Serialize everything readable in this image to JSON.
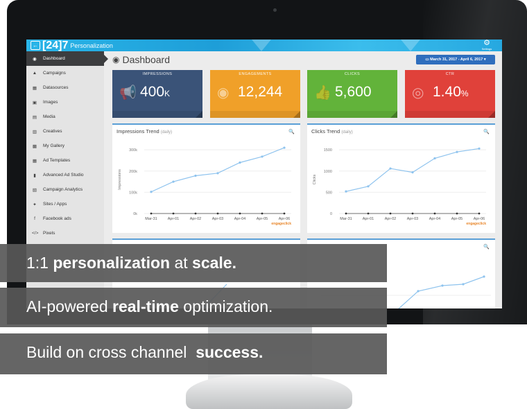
{
  "app": {
    "logo_num": "[24]7",
    "logo_sub": "Personalization",
    "settings_label": "Settings"
  },
  "sidebar": {
    "items": [
      {
        "label": "Dashboard",
        "icon": "dashboard-icon",
        "glyph": "◉",
        "active": true
      },
      {
        "label": "Campaigns",
        "icon": "campaigns-icon",
        "glyph": "▲"
      },
      {
        "label": "Datasources",
        "icon": "datasources-icon",
        "glyph": "▦"
      },
      {
        "label": "Images",
        "icon": "images-icon",
        "glyph": "▣"
      },
      {
        "label": "Media",
        "icon": "media-icon",
        "glyph": "▤"
      },
      {
        "label": "Creatives",
        "icon": "creatives-icon",
        "glyph": "▥"
      },
      {
        "label": "My Gallery",
        "icon": "gallery-icon",
        "glyph": "▩"
      },
      {
        "label": "Ad Templates",
        "icon": "templates-icon",
        "glyph": "▦"
      },
      {
        "label": "Advanced Ad Studio",
        "icon": "studio-icon",
        "glyph": "▮"
      },
      {
        "label": "Campaign Analytics",
        "icon": "analytics-icon",
        "glyph": "▧"
      },
      {
        "label": "Sites / Apps",
        "icon": "sites-icon",
        "glyph": "✦"
      },
      {
        "label": "Facebook ads",
        "icon": "facebook-icon",
        "glyph": "f"
      },
      {
        "label": "Pixels",
        "icon": "pixels-icon",
        "glyph": "</>"
      }
    ]
  },
  "header": {
    "title": "Dashboard",
    "date_range": "March 31, 2017 - April 6, 2017 ▾"
  },
  "stats": [
    {
      "label": "IMPRESSIONS",
      "value": "400",
      "unit": "K",
      "color": "#3a5378",
      "icon": "megaphone-icon",
      "glyph": "📢"
    },
    {
      "label": "ENGAGEMENTS",
      "value": "12,244",
      "unit": "",
      "color": "#f0a029",
      "icon": "eye-icon",
      "glyph": "◉"
    },
    {
      "label": "CLICKS",
      "value": "5,600",
      "unit": "",
      "color": "#62b33a",
      "icon": "thumbs-up-icon",
      "glyph": "👍"
    },
    {
      "label": "CTR",
      "value": "1.40",
      "unit": "%",
      "color": "#e0413a",
      "icon": "target-icon",
      "glyph": "◎"
    }
  ],
  "colors": {
    "accent": "#5a9fd6",
    "line": "#8ec3ee"
  },
  "chart_data": [
    {
      "type": "line",
      "title": "Impressions Trend",
      "subtitle": "(daily)",
      "ylabel": "Impressions",
      "categories": [
        "Mar-31",
        "Apr-01",
        "Apr-02",
        "Apr-03",
        "Apr-04",
        "Apr-05",
        "Apr-06"
      ],
      "ylim": [
        0,
        320000
      ],
      "ticks": [
        0,
        100000,
        200000,
        300000
      ],
      "tick_labels": [
        "0k",
        "100k",
        "200k",
        "300k"
      ],
      "series": [
        {
          "values": [
            102000,
            150000,
            178000,
            190000,
            240000,
            268000,
            310000
          ]
        }
      ],
      "watermark": "engageclick"
    },
    {
      "type": "line",
      "title": "Clicks Trend",
      "subtitle": "(daily)",
      "ylabel": "Clicks",
      "categories": [
        "Mar-31",
        "Apr-01",
        "Apr-02",
        "Apr-03",
        "Apr-04",
        "Apr-05",
        "Apr-06"
      ],
      "ylim": [
        0,
        1600
      ],
      "ticks": [
        0,
        500,
        1000,
        1500
      ],
      "tick_labels": [
        "0",
        "500",
        "1000",
        "1500"
      ],
      "series": [
        {
          "values": [
            520,
            640,
            1060,
            970,
            1300,
            1450,
            1530
          ]
        }
      ],
      "watermark": "engageclick"
    }
  ],
  "captions": [
    {
      "parts": [
        {
          "t": "1:1 ",
          "b": false
        },
        {
          "t": "personalization",
          "b": true
        },
        {
          "t": " at ",
          "b": false
        },
        {
          "t": "scale.",
          "b": true
        }
      ]
    },
    {
      "parts": [
        {
          "t": "AI-powered ",
          "b": false
        },
        {
          "t": "real-time",
          "b": true
        },
        {
          "t": " optimization.",
          "b": false
        }
      ]
    },
    {
      "parts": [
        {
          "t": "Build on cross channel  ",
          "b": false
        },
        {
          "t": "success.",
          "b": true
        }
      ]
    }
  ]
}
